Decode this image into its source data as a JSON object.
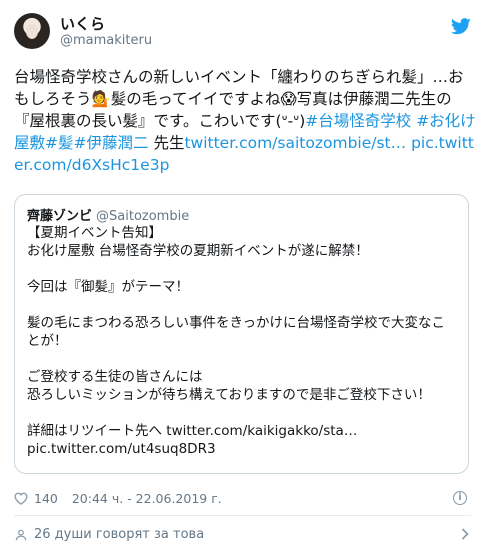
{
  "author": {
    "name": "いくら",
    "handle": "@mamakiteru"
  },
  "tweet": {
    "text_1": "台場怪奇学校さんの新しいイベント「纏わりのちぎられ髪」…おもしろそう💁髪の毛ってイイですよね😱写真は伊藤潤二先生の『屋根裏の長い髪』です。こわいです(ᐡ-ᐡ)",
    "hashtag_1": "#台場怪奇学校",
    "hashtag_2": "#お化け屋敷",
    "hashtag_3": "#髪",
    "hashtag_4": "#伊藤潤二",
    "text_2": " 先生",
    "link_1": "twitter.com/saitozombie/st…",
    "link_2": "pic.twitter.com/d6XsHc1e3p"
  },
  "quoted": {
    "name": "齊藤ゾンビ",
    "handle": "@Saitozombie",
    "text": "【夏期イベント告知】\nお化け屋敷 台場怪奇学校の夏期新イベントが遂に解禁！\n\n今回は『御髪』がテーマ！\n\n髪の毛にまつわる恐ろしい事件をきっかけに台場怪奇学校で大変なことが！\n\nご登校する生徒の皆さんには\n恐ろしいミッションが待ち構えておりますので是非ご登校下さい！\n\n詳細はリツイート先へ twitter.com/kaikigakko/sta…\npic.twitter.com/ut4suq8DR3"
  },
  "meta": {
    "likes": "140",
    "timestamp": "20:44 ч. - 22.06.2019 г."
  },
  "footer": {
    "talking": "26 души говорят за това"
  },
  "colors": {
    "link": "#1b95e0",
    "muted": "#657786",
    "border": "#ccd6dd",
    "twitter_blue": "#1da1f2"
  }
}
